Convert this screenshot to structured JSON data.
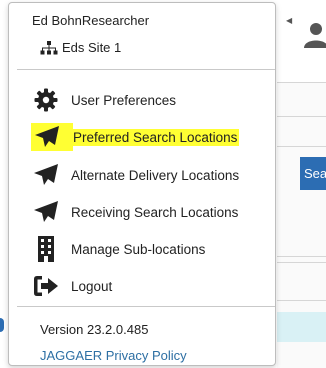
{
  "user": {
    "name": "Ed BohnResearcher",
    "site_label": "Eds Site 1"
  },
  "menu": {
    "items": [
      {
        "label": "User Preferences",
        "icon": "gear-icon"
      },
      {
        "label": "Preferred Search Locations",
        "icon": "paper-plane-icon",
        "highlighted": true
      },
      {
        "label": "Alternate Delivery Locations",
        "icon": "paper-plane-icon"
      },
      {
        "label": "Receiving Search Locations",
        "icon": "paper-plane-icon"
      },
      {
        "label": "Manage Sub-locations",
        "icon": "building-icon"
      },
      {
        "label": "Logout",
        "icon": "sign-out-icon"
      }
    ]
  },
  "footer": {
    "version": "Version 23.2.0.485",
    "privacy_link": "JAGGAER Privacy Policy"
  },
  "background": {
    "search_button_label": "Sea"
  },
  "colors": {
    "highlight": "#ffff33",
    "link": "#2d6fa3",
    "search_button": "#2c6db3",
    "info_band": "#d9f1f5"
  }
}
